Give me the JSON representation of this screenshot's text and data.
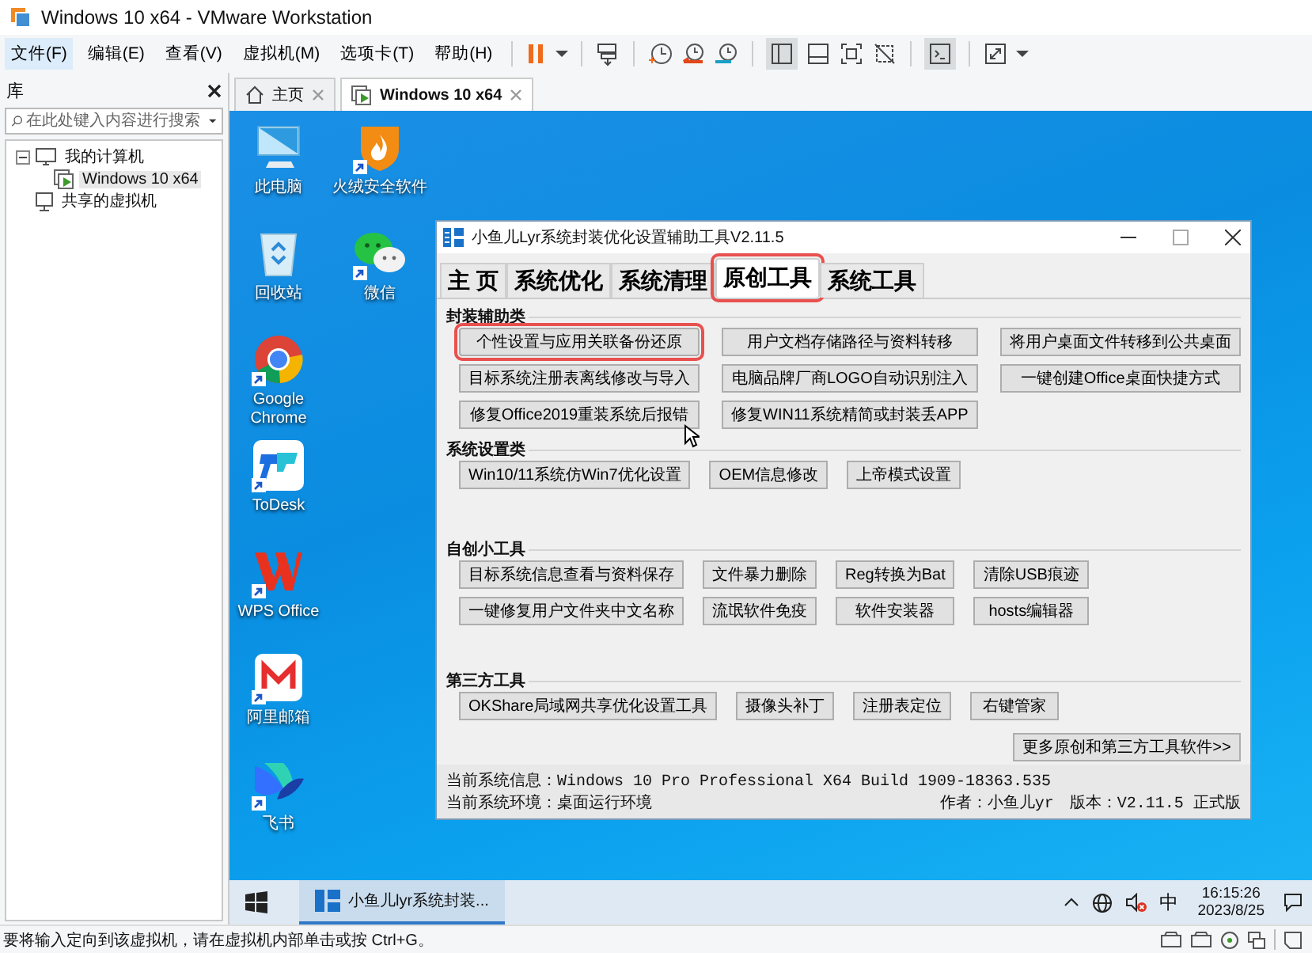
{
  "window": {
    "title": "Windows 10 x64 - VMware Workstation"
  },
  "menu": [
    {
      "label": "文件(F)",
      "selected": true
    },
    {
      "label": "编辑(E)",
      "selected": false
    },
    {
      "label": "查看(V)",
      "selected": false
    },
    {
      "label": "虚拟机(M)",
      "selected": false
    },
    {
      "label": "选项卡(T)",
      "selected": false
    },
    {
      "label": "帮助(H)",
      "selected": false
    }
  ],
  "library": {
    "title": "库",
    "search": {
      "placeholder": "在此处键入内容进行搜索"
    },
    "tree": [
      {
        "label": "我的计算机",
        "kind": "computer",
        "selected": false,
        "expanded": true,
        "children": [
          {
            "label": "Windows 10 x64",
            "kind": "vm",
            "selected": true
          }
        ]
      },
      {
        "label": "共享的虚拟机",
        "kind": "shared",
        "selected": false
      }
    ]
  },
  "vm_tabs": [
    {
      "label": "主页",
      "kind": "home",
      "selected": false
    },
    {
      "label": "Windows 10 x64",
      "kind": "vm",
      "selected": true
    }
  ],
  "desktop": {
    "icons": [
      {
        "label": "此电脑",
        "kind": "computer",
        "shortcut": false
      },
      {
        "label": "火绒安全软件",
        "kind": "shield",
        "shortcut": true
      },
      {
        "label": "回收站",
        "kind": "recycle",
        "shortcut": false
      },
      {
        "label": "微信",
        "kind": "chat",
        "shortcut": true
      },
      {
        "label": "Google Chrome",
        "kind": "browser",
        "shortcut": true
      },
      {
        "label": "ToDesk",
        "kind": "remote",
        "shortcut": true
      },
      {
        "label": "WPS Office",
        "kind": "office",
        "shortcut": true
      },
      {
        "label": "阿里邮箱",
        "kind": "mail",
        "shortcut": true
      },
      {
        "label": "飞书",
        "kind": "bird",
        "shortcut": true
      }
    ]
  },
  "tool_window": {
    "title": "小鱼儿Lyr系统封装优化设置辅助工具V2.11.5",
    "tabs": [
      {
        "label": "主 页",
        "selected": false,
        "highlighted": false
      },
      {
        "label": "系统优化",
        "selected": false,
        "highlighted": false
      },
      {
        "label": "系统清理",
        "selected": false,
        "highlighted": false
      },
      {
        "label": "原创工具",
        "selected": true,
        "highlighted": true
      },
      {
        "label": "系统工具",
        "selected": false,
        "highlighted": false
      }
    ],
    "groups": [
      {
        "title": "封装辅助类",
        "buttons": [
          {
            "label": "个性设置与应用关联备份还原",
            "highlighted": true
          },
          {
            "label": "用户文档存储路径与资料转移",
            "highlighted": false
          },
          {
            "label": "将用户桌面文件转移到公共桌面",
            "highlighted": false
          },
          {
            "label": "目标系统注册表离线修改与导入",
            "highlighted": false
          },
          {
            "label": "电脑品牌厂商LOGO自动识别注入",
            "highlighted": false
          },
          {
            "label": "一键创建Office桌面快捷方式",
            "highlighted": false
          },
          {
            "label": "修复Office2019重装系统后报错",
            "highlighted": false
          },
          {
            "label": "修复WIN11系统精简或封装丢APP",
            "highlighted": false
          }
        ]
      },
      {
        "title": "系统设置类",
        "buttons": [
          {
            "label": "Win10/11系统仿Win7优化设置",
            "highlighted": false
          },
          {
            "label": "OEM信息修改",
            "highlighted": false
          },
          {
            "label": "上帝模式设置",
            "highlighted": false
          }
        ]
      },
      {
        "title": "自创小工具",
        "buttons": [
          {
            "label": "目标系统信息查看与资料保存",
            "highlighted": false
          },
          {
            "label": "文件暴力删除",
            "highlighted": false
          },
          {
            "label": "Reg转换为Bat",
            "highlighted": false
          },
          {
            "label": "清除USB痕迹",
            "highlighted": false
          },
          {
            "label": "一键修复用户文件夹中文名称",
            "highlighted": false
          },
          {
            "label": "流氓软件免疫",
            "highlighted": false
          },
          {
            "label": "软件安装器",
            "highlighted": false
          },
          {
            "label": "hosts编辑器",
            "highlighted": false
          }
        ]
      },
      {
        "title": "第三方工具",
        "buttons": [
          {
            "label": "OKShare局域网共享优化设置工具",
            "highlighted": false
          },
          {
            "label": "摄像头补丁",
            "highlighted": false
          },
          {
            "label": "注册表定位",
            "highlighted": false
          },
          {
            "label": "右键管家",
            "highlighted": false
          }
        ]
      }
    ],
    "more_button": "更多原创和第三方工具软件>>",
    "status": {
      "system_info": "当前系统信息：Windows 10 Pro Professional X64 Build 1909-18363.535",
      "environment": "当前系统环境：桌面运行环境",
      "author": "作者：小鱼儿yr",
      "version": "版本：V2.11.5 正式版"
    }
  },
  "taskbar": {
    "apps": [
      {
        "label": "小鱼儿lyr系统封装...",
        "selected": true
      }
    ],
    "ime": "中",
    "time": "16:15:26",
    "date": "2023/8/25"
  },
  "status_bar": "要将输入定向到该虚拟机，请在虚拟机内部单击或按 Ctrl+G。"
}
